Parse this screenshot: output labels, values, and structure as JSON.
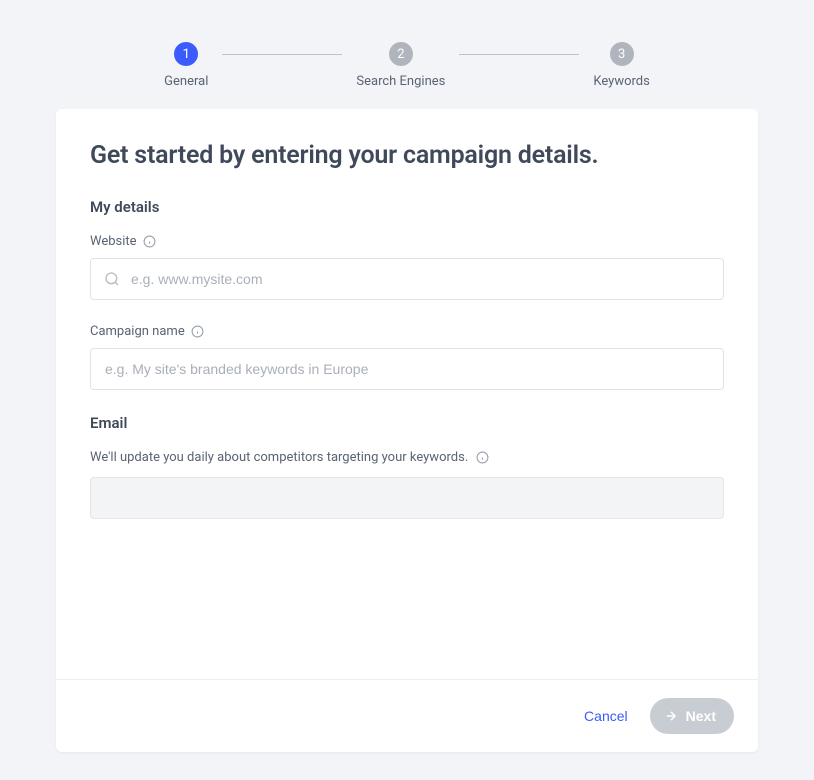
{
  "stepper": {
    "steps": [
      {
        "num": "1",
        "label": "General",
        "active": true
      },
      {
        "num": "2",
        "label": "Search Engines",
        "active": false
      },
      {
        "num": "3",
        "label": "Keywords",
        "active": false
      }
    ]
  },
  "card": {
    "title": "Get started by entering your campaign details.",
    "sections": {
      "details": {
        "heading": "My details",
        "website": {
          "label": "Website",
          "placeholder": "e.g. www.mysite.com",
          "value": ""
        },
        "campaign": {
          "label": "Campaign name",
          "placeholder": "e.g. My site's branded keywords in Europe",
          "value": ""
        }
      },
      "email": {
        "heading": "Email",
        "hint": "We'll update you daily about competitors targeting your keywords.",
        "value": ""
      }
    }
  },
  "footer": {
    "cancel": "Cancel",
    "next": "Next"
  }
}
